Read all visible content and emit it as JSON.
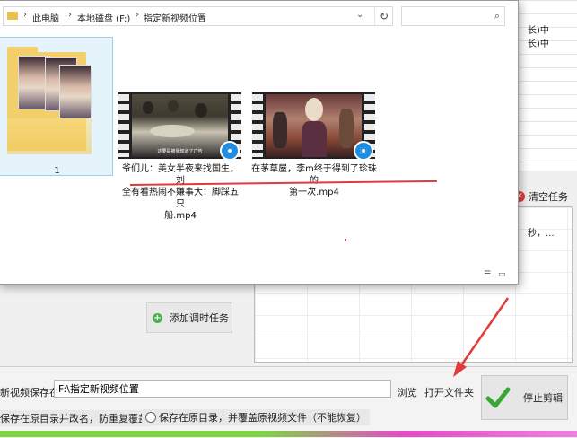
{
  "explorer": {
    "breadcrumb": [
      "此电脑",
      "本地磁盘 (F:)",
      "指定新视频位置"
    ],
    "items": [
      {
        "label": "1"
      },
      {
        "label": "爷们儿：美女半夜来找国生，刘全有看热闹不嫌事大：脚踩五只船.mp4",
        "line1": "爷们儿：美女半夜来找国生，刘",
        "line2": "全有看热闹不嫌事大：脚踩五只",
        "line3": "船.mp4",
        "subtitle": "这要是被我知道了广告"
      },
      {
        "label": "在茅草屋，李m终于得到了珍珠的第一次.mp4",
        "line1": "在茅草屋，李m终于得到了珍珠的",
        "line2": "第一次.mp4"
      }
    ]
  },
  "background": {
    "right_lines": [
      "长)中",
      "长)中"
    ],
    "clear_task": "清空任务",
    "log_text": "秒，...",
    "add_task": "添加调时任务"
  },
  "bottom": {
    "save_label": "新视频保存在：",
    "save_path": "F:\\指定新视频位置",
    "browse": "浏览",
    "open_folder": "打开文件夹",
    "option1": "保存在原目录并改名，防重复覆盖",
    "option2": "保存在原目录，并覆盖原视频文件（不能恢复）",
    "stop": "停止剪辑"
  },
  "colors": {
    "accent_red": "#e23a3a",
    "badge_blue": "#1e8ce0",
    "progress_green": "#7bd641",
    "progress_pink": "#e84ac8"
  }
}
